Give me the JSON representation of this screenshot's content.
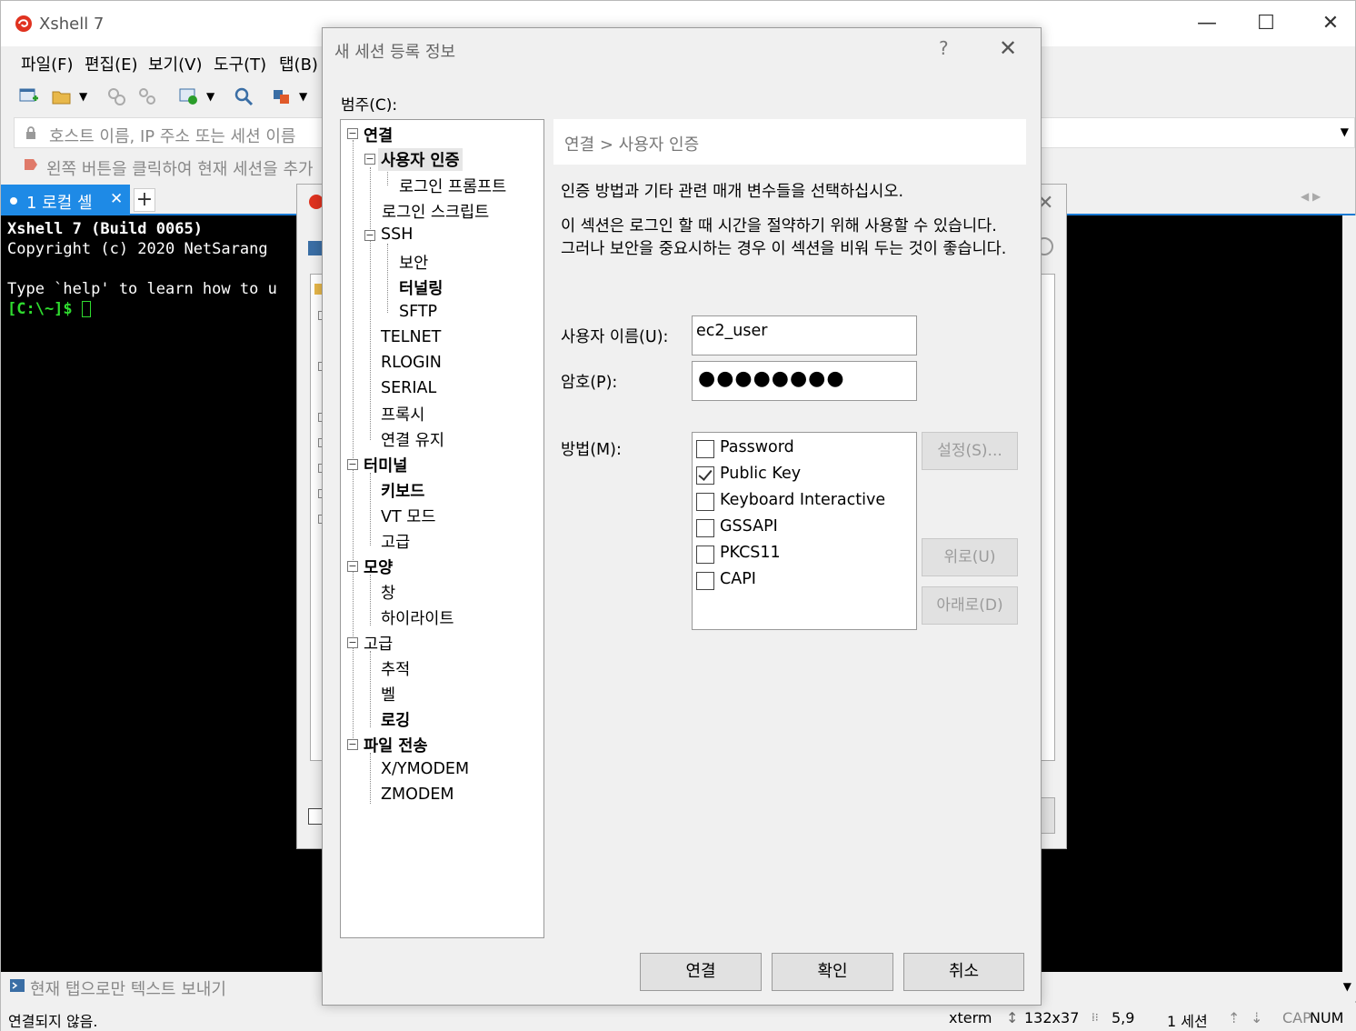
{
  "window": {
    "title": "Xshell 7",
    "controls": {
      "minimize": "—",
      "maximize": "☐",
      "close": "✕"
    }
  },
  "menu": [
    "파일(F)",
    "편집(E)",
    "보기(V)",
    "도구(T)",
    "탭(B)"
  ],
  "address": {
    "placeholder": "호스트 이름, IP 주소 또는 세션 이름"
  },
  "hint": {
    "text": "왼쪽 버튼을 클릭하여 현재 세션을 추가"
  },
  "tabs": {
    "active_label": "1 로컬 셸",
    "close": "✕",
    "add": "+"
  },
  "terminal": {
    "line1": "Xshell 7 (Build 0065)",
    "line2": "Copyright (c) 2020 NetSarang",
    "line3": "",
    "line4": "Type `help' to learn how to u",
    "prompt": "[C:\\~]$ "
  },
  "sendbar": {
    "text": "현재 탭으로만 텍스트 보내기"
  },
  "status": {
    "connection": "연결되지 않음.",
    "terminal_type": "xterm",
    "size": "132x37",
    "cursor_pos": "5,9",
    "sessions": "1 세션",
    "caps": "CAP",
    "num": "NUM"
  },
  "dialog": {
    "title": "새 세션 등록 정보",
    "help": "?",
    "close": "✕",
    "category_label": "범주(C):",
    "tree": {
      "connection": "연결",
      "user_auth": "사용자 인증",
      "login_prompt": "로그인 프롬프트",
      "login_script": "로그인 스크립트",
      "ssh": "SSH",
      "security": "보안",
      "tunneling": "터널링",
      "sftp": "SFTP",
      "telnet": "TELNET",
      "rlogin": "RLOGIN",
      "serial": "SERIAL",
      "proxy": "프록시",
      "keepalive": "연결 유지",
      "terminal": "터미널",
      "keyboard": "키보드",
      "vt_mode": "VT 모드",
      "advanced_terminal": "고급",
      "appearance": "모양",
      "window": "창",
      "highlight": "하이라이트",
      "advanced": "고급",
      "trace": "추적",
      "bell": "벨",
      "logging": "로깅",
      "file_transfer": "파일 전송",
      "xymodem": "X/YMODEM",
      "zmodem": "ZMODEM"
    },
    "breadcrumb": "연결 > 사용자 인증",
    "description1": "인증 방법과 기타 관련 매개 변수들을 선택하십시오.",
    "description2": "이 섹션은 로그인 할 때 시간을 절약하기 위해 사용할 수 있습니다. 그러나 보안을 중요시하는 경우 이 섹션을 비워 두는 것이 좋습니다.",
    "username_label": "사용자 이름(U):",
    "username_value": "ec2_user",
    "password_label": "암호(P):",
    "password_value": "●●●●●●●●",
    "method_label": "방법(M):",
    "methods": [
      {
        "label": "Password",
        "checked": false
      },
      {
        "label": "Public Key",
        "checked": true
      },
      {
        "label": "Keyboard Interactive",
        "checked": false
      },
      {
        "label": "GSSAPI",
        "checked": false
      },
      {
        "label": "PKCS11",
        "checked": false
      },
      {
        "label": "CAPI",
        "checked": false
      }
    ],
    "setup_button": "설정(S)...",
    "up_button": "위로(U)",
    "down_button": "아래로(D)",
    "connect_button": "연결",
    "ok_button": "확인",
    "cancel_button": "취소"
  },
  "colors": {
    "tab_active": "#1e8ae6",
    "prompt_green": "#2fdc2f",
    "terminal_bg": "#000000"
  }
}
